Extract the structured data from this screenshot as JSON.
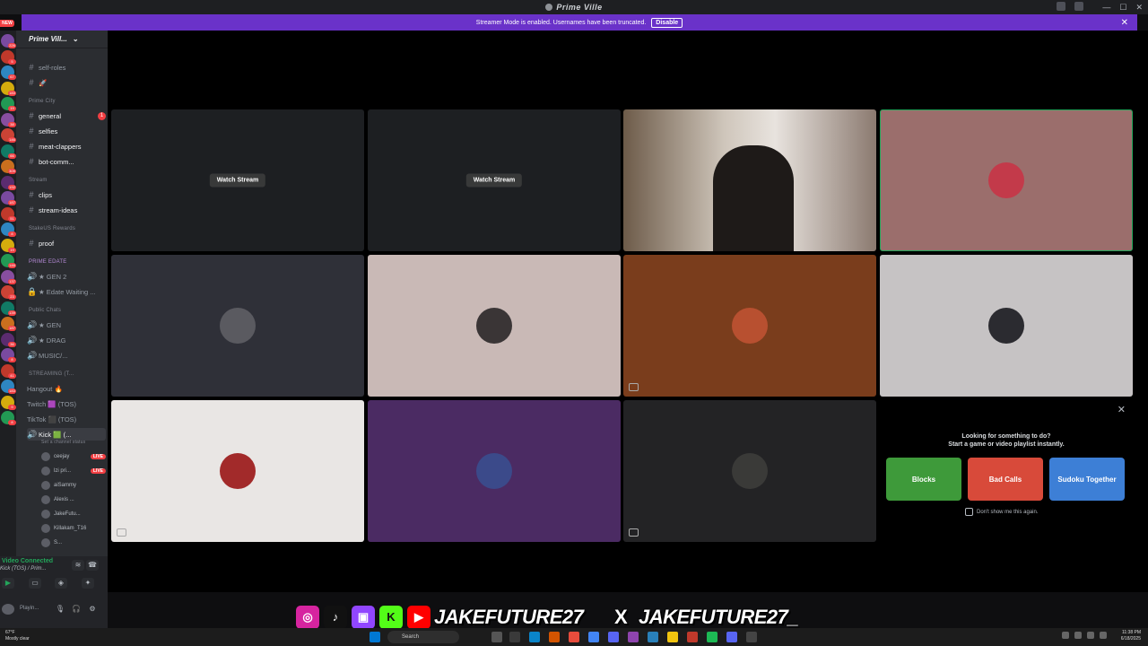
{
  "window": {
    "title": "Prime Ville"
  },
  "banner": {
    "text": "Streamer Mode is enabled. Usernames have been truncated.",
    "button": "Disable",
    "close": "✕"
  },
  "rail": {
    "new_badge": "NEW",
    "badges": [
      "226",
      "5",
      "67",
      "183",
      "19",
      "38",
      "146",
      "66",
      "309",
      "192",
      "187",
      "51",
      "8",
      "19",
      "146",
      "137",
      "23",
      "139",
      "187",
      "36",
      "8",
      "41",
      "183",
      "9",
      "8"
    ]
  },
  "sidebar": {
    "server_name": "Prime Vill...",
    "channels_top": [
      {
        "name": "self-roles"
      },
      {
        "name": "🚀"
      }
    ],
    "cat_prime_city": "Prime City",
    "channels_city": [
      {
        "name": "general",
        "unread": "1",
        "active": true
      },
      {
        "name": "selfies",
        "active": true
      },
      {
        "name": "meat-clappers",
        "active": true
      },
      {
        "name": "bot-comm...",
        "active": true
      }
    ],
    "cat_stream": "Stream",
    "channels_stream": [
      {
        "name": "clips",
        "active": true
      },
      {
        "name": "stream-ideas",
        "active": true
      }
    ],
    "cat_stakeus": "StakeUS Rewards",
    "channels_stakeus": [
      {
        "name": "proof",
        "active": true
      }
    ],
    "cat_edate": "PRIME EDATE",
    "voice_edate": [
      {
        "name": "★ GEN 2"
      },
      {
        "name": "★ Edate Waiting ..."
      }
    ],
    "cat_public": "Public Chats",
    "voice_public": [
      {
        "name": "★ GEN"
      },
      {
        "name": "★ DRAG"
      },
      {
        "name": "MUSIC/..."
      }
    ],
    "cat_streaming": "STREAMING (T...",
    "voice_streaming": [
      {
        "name": "Hangout 🔥"
      },
      {
        "name": "Twitch 🟪 (TOS)"
      },
      {
        "name": "TikTok ⬛ (TOS)"
      },
      {
        "name": "Kick 🟩 (..."
      }
    ],
    "kick_status": "Set a channel status",
    "voice_users": [
      {
        "name": "ceejay",
        "live": "LIVE"
      },
      {
        "name": "lzi pri...",
        "live": "LIVE"
      },
      {
        "name": "aiSammy",
        "live": ""
      },
      {
        "name": "Alexis ...",
        "live": ""
      },
      {
        "name": "JakeFutu...",
        "live": ""
      },
      {
        "name": "Killakam_T16",
        "live": ""
      },
      {
        "name": "S...",
        "live": ""
      }
    ]
  },
  "voice_panel": {
    "status": "Video Connected",
    "channel": "Kick (TOS) / Prim..."
  },
  "user_panel": {
    "name": "Playin..."
  },
  "grid": {
    "watch_label": "Watch Stream",
    "tiles": [
      {
        "color": "#1d1f22",
        "kind": "stream"
      },
      {
        "color": "#1d1f22",
        "kind": "stream"
      },
      {
        "color": "#5a4a3a",
        "kind": "camera"
      },
      {
        "color": "#9b6e6c",
        "kind": "avatar",
        "avatar": "#c33a4a"
      },
      {
        "color": "#2f3038",
        "kind": "avatar",
        "avatar": "#5a5a60"
      },
      {
        "color": "#c9b9b6",
        "kind": "avatar",
        "avatar": "#3a3536"
      },
      {
        "color": "#7a3d1c",
        "kind": "avatar",
        "avatar": "#b85030"
      },
      {
        "color": "#c6c3c4",
        "kind": "avatar",
        "avatar": "#2b2b30"
      },
      {
        "color": "#e9e6e4",
        "kind": "avatar",
        "avatar": "#a22a2a"
      },
      {
        "color": "#4b2b63",
        "kind": "avatar",
        "avatar": "#3b4a8a"
      },
      {
        "color": "#232325",
        "kind": "avatar",
        "avatar": "#3a3a38"
      }
    ]
  },
  "suggest": {
    "line1": "Looking for something to do?",
    "line2": "Start a game or video playlist instantly.",
    "games": [
      {
        "name": "Blocks",
        "color": "#3e9a3a"
      },
      {
        "name": "Bad Calls",
        "color": "#d84a3a"
      },
      {
        "name": "Sudoku Together",
        "color": "#3d7fd6"
      }
    ],
    "checkbox": "Don't show me this again."
  },
  "overlay": {
    "handle1": "JAKEFUTURE27",
    "handle2": "JAKEFUTURE27_",
    "x_icon": "X"
  },
  "taskbar": {
    "weather_temp": "67°F",
    "weather_text": "Mostly clear",
    "search": "Search",
    "time": "11:38 PM",
    "date": "6/18/2025"
  }
}
